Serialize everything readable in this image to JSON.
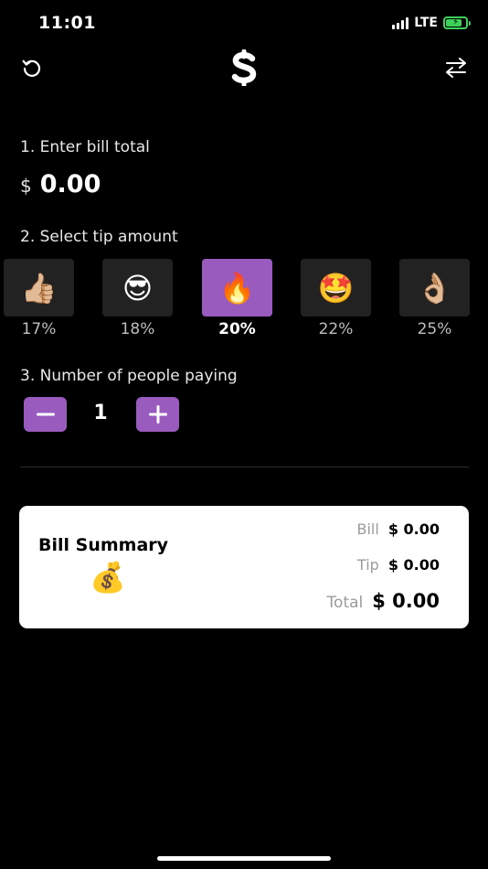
{
  "status": {
    "time": "11:01",
    "network": "LTE",
    "battery_icon": "battery-charging-icon",
    "accent_color": "#3dd35b"
  },
  "nav": {
    "left_icon": "reset-icon",
    "logo_icon": "dollar-logo-icon",
    "right_icon": "swap-arrows-icon"
  },
  "bill": {
    "label": "1. Enter bill total",
    "currency": "$",
    "value": "0.00"
  },
  "tip": {
    "label": "2. Select tip amount",
    "selected_index": 2,
    "accent_color": "#9a5bbf",
    "options": [
      {
        "emoji": "👍🏼",
        "percent": "17%"
      },
      {
        "emoji": "😎",
        "percent": "18%"
      },
      {
        "emoji": "🔥",
        "percent": "20%"
      },
      {
        "emoji": "🤩",
        "percent": "22%"
      },
      {
        "emoji": "👌🏼",
        "percent": "25%"
      }
    ]
  },
  "people": {
    "label": "3. Number of people paying",
    "count": "1",
    "minus_icon": "minus-icon",
    "plus_icon": "plus-icon"
  },
  "summary": {
    "title": "Bill Summary",
    "emoji": "💰",
    "bill_label": "Bill",
    "bill_value": "$ 0.00",
    "tip_label": "Tip",
    "tip_value": "$ 0.00",
    "total_label": "Total",
    "total_value": "$ 0.00"
  }
}
